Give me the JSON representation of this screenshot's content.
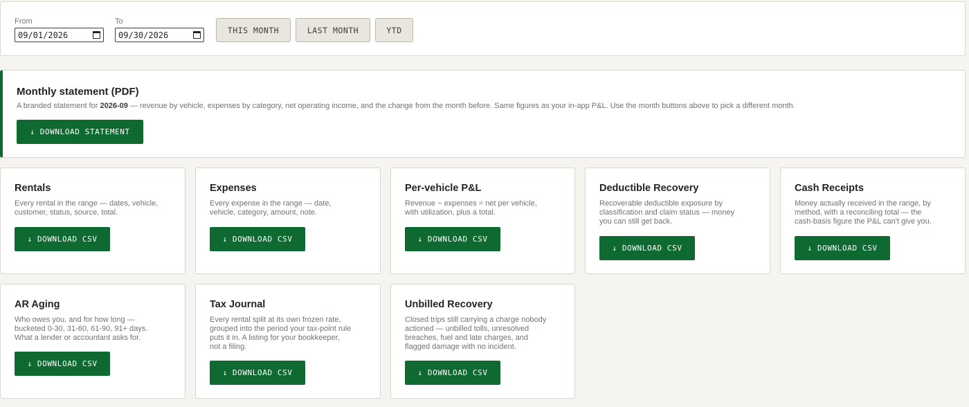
{
  "range": {
    "from_label": "From",
    "from_value": "09/01/2026",
    "to_label": "To",
    "to_value": "09/30/2026",
    "presets": [
      "THIS MONTH",
      "LAST MONTH",
      "YTD"
    ]
  },
  "statement": {
    "title": "Monthly statement (PDF)",
    "desc_prefix": "A branded statement for ",
    "desc_month": "2026-09",
    "desc_suffix": " — revenue by vehicle, expenses by category, net operating income, and the change from the month before. Same figures as your in-app P&L. Use the month buttons above to pick a different month.",
    "button": "↓ DOWNLOAD STATEMENT"
  },
  "cards": [
    {
      "title": "Rentals",
      "lines": [
        "Every rental in the range — dates, vehicle,",
        "customer, status, source, total."
      ],
      "button": "↓ DOWNLOAD CSV"
    },
    {
      "title": "Expenses",
      "lines": [
        "Every expense in the range — date,",
        "vehicle, category, amount, note."
      ],
      "button": "↓ DOWNLOAD CSV"
    },
    {
      "title": "Per-vehicle P&L",
      "lines": [
        "Revenue − expenses = net per vehicle,",
        "with utilization, plus a total."
      ],
      "button": "↓ DOWNLOAD CSV"
    },
    {
      "title": "Deductible Recovery",
      "lines": [
        "Recoverable deductible exposure by",
        "classification and claim status — money",
        "you can still get back."
      ],
      "button": "↓ DOWNLOAD CSV"
    },
    {
      "title": "Cash Receipts",
      "lines": [
        "Money actually received in the range, by",
        "method, with a reconciling total — the",
        "cash-basis figure the P&L can't give you."
      ],
      "button": "↓ DOWNLOAD CSV"
    },
    {
      "title": "AR Aging",
      "lines": [
        "Who owes you, and for how long —",
        "bucketed 0-30, 31-60, 61-90, 91+ days.",
        "What a lender or accountant asks for."
      ],
      "button": "↓ DOWNLOAD CSV"
    },
    {
      "title": "Tax Journal",
      "lines": [
        "Every rental split at its own frozen rate,",
        "grouped into the period your tax-point rule",
        "puts it in. A listing for your bookkeeper,",
        "not a filing."
      ],
      "button": "↓ DOWNLOAD CSV"
    },
    {
      "title": "Unbilled Recovery",
      "lines": [
        "Closed trips still carrying a charge nobody",
        "actioned — unbilled tolls, unresolved",
        "breaches, fuel and late charges, and",
        "flagged damage with no incident."
      ],
      "button": "↓ DOWNLOAD CSV"
    }
  ],
  "colors": {
    "accent": "#0e6a30",
    "background": "#f5f4f0",
    "muted_text": "#6f746e"
  },
  "icons": {
    "calendar": "calendar-icon"
  }
}
